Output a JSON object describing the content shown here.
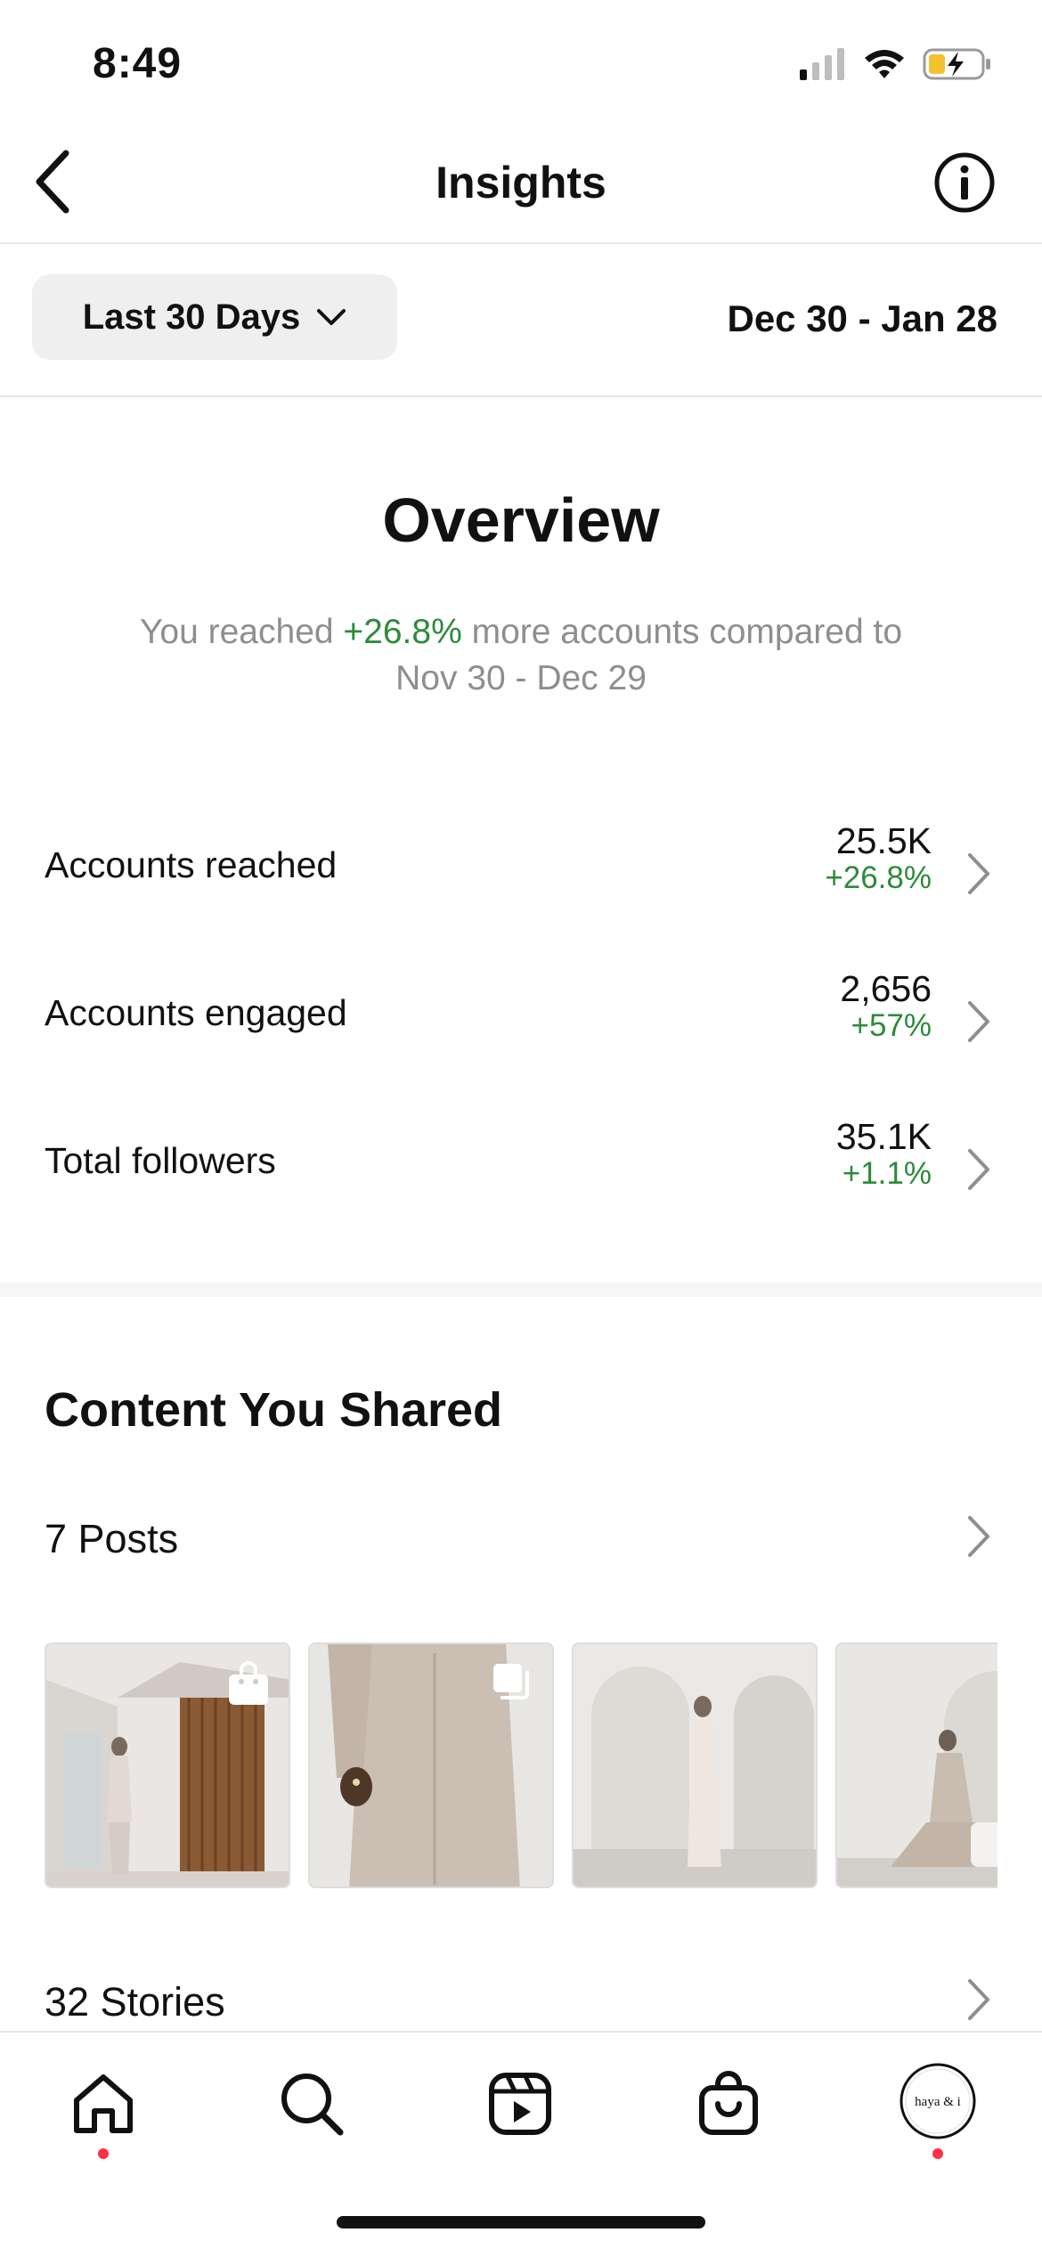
{
  "status_bar": {
    "time": "8:49"
  },
  "header": {
    "title": "Insights"
  },
  "filter": {
    "range_label": "Last 30 Days",
    "date_range": "Dec 30 - Jan 28"
  },
  "overview": {
    "title": "Overview",
    "summary_prefix": "You reached ",
    "summary_highlight": "+26.8%",
    "summary_suffix": " more accounts compared to Nov 30 - Dec 29",
    "metrics": [
      {
        "label": "Accounts reached",
        "value": "25.5K",
        "change": "+26.8%"
      },
      {
        "label": "Accounts engaged",
        "value": "2,656",
        "change": "+57%"
      },
      {
        "label": "Total followers",
        "value": "35.1K",
        "change": "+1.1%"
      }
    ]
  },
  "content": {
    "title": "Content You Shared",
    "posts_label": "7 Posts",
    "stories_label": "32 Stories",
    "thumbnails": [
      {
        "badge": "shopping-bag-icon"
      },
      {
        "badge": "carousel-icon"
      },
      {
        "badge": ""
      },
      {
        "badge": ""
      }
    ]
  },
  "tabbar": {
    "items": [
      "home-icon",
      "search-icon",
      "reels-icon",
      "shop-icon",
      "profile-avatar"
    ],
    "avatar_text": "haya & i"
  },
  "colors": {
    "positive": "#2e8a3b",
    "notification": "#ff3040",
    "muted": "#8e8e8e"
  }
}
